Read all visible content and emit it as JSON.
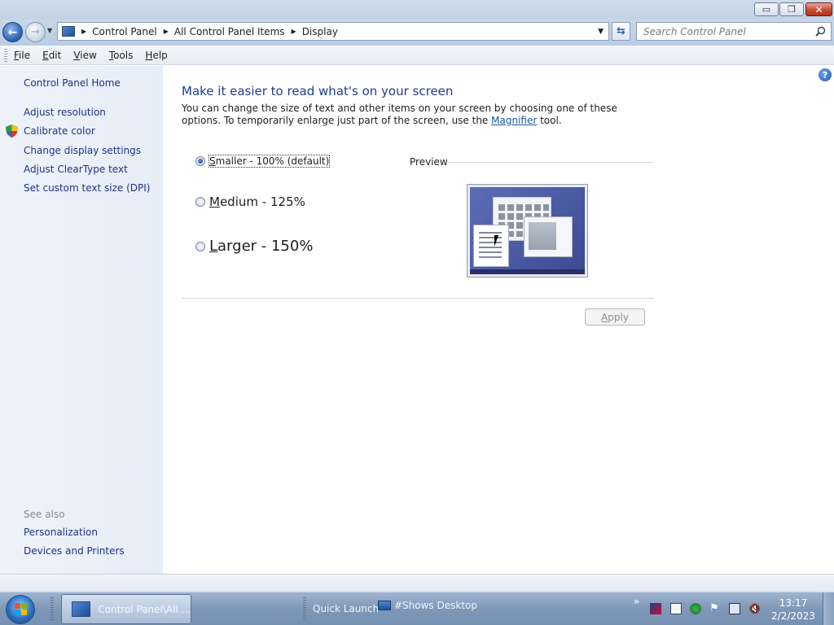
{
  "window": {
    "minimize_glyph": "▭",
    "restore_glyph": "❐",
    "close_glyph": "✕"
  },
  "address": {
    "crumbs": [
      "Control Panel",
      "All Control Panel Items",
      "Display"
    ],
    "search_placeholder": "Search Control Panel"
  },
  "menu": {
    "file": "F",
    "file_rest": "ile",
    "edit": "E",
    "edit_rest": "dit",
    "view": "V",
    "view_rest": "iew",
    "tools": "T",
    "tools_rest": "ools",
    "help": "H",
    "help_rest": "elp"
  },
  "sidebar": {
    "home": "Control Panel Home",
    "tasks": [
      "Adjust resolution",
      "Calibrate color",
      "Change display settings",
      "Adjust ClearType text",
      "Set custom text size (DPI)"
    ],
    "see_also_heading": "See also",
    "see_also": [
      "Personalization",
      "Devices and Printers"
    ]
  },
  "main": {
    "heading": "Make it easier to read what's on your screen",
    "intro_before_link": "You can change the size of text and other items on your screen by choosing one of these options. To temporarily enlarge just part of the screen, use the ",
    "intro_link": "Magnifier",
    "intro_after_link": " tool.",
    "options": [
      {
        "accel": "S",
        "label_rest": "maller - 100% (default)",
        "checked": true
      },
      {
        "accel": "M",
        "label_rest": "edium - 125%",
        "checked": false
      },
      {
        "accel": "L",
        "label_rest": "arger - 150%",
        "checked": false
      }
    ],
    "preview_label": "Preview",
    "apply_accel": "A",
    "apply_rest": "pply"
  },
  "taskbar": {
    "active_window": "Control Panel\\All ...",
    "quick_launch": "Quick Launch",
    "shows_desktop": "#Shows Desktop",
    "time": "13:17",
    "date": "2/2/2023"
  },
  "colors": {
    "link": "#1e3287",
    "heading": "#1e3c8c",
    "sidebar_bg": "#eef3fa",
    "taskbar": "#7f98b9"
  }
}
